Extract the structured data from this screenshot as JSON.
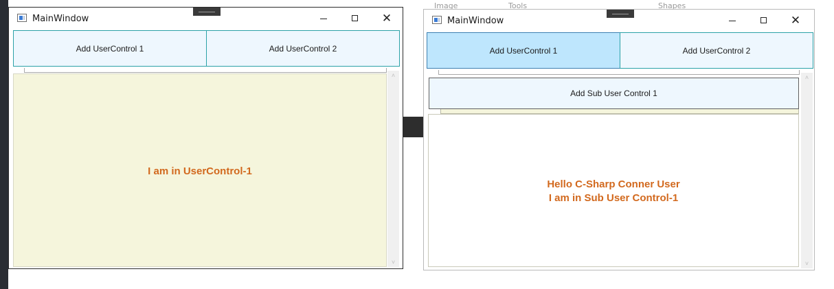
{
  "background": {
    "labels": [
      "Image",
      "Tools",
      "Shapes"
    ]
  },
  "windows": [
    {
      "title": "MainWindow",
      "buttons": {
        "add1": "Add UserControl 1",
        "add2": "Add UserControl 2"
      },
      "content": {
        "message": "I am in UserControl-1",
        "background": "#f5f5dc"
      },
      "scroll": {
        "up": "˄",
        "down": "˅"
      },
      "controls": {
        "close": "✕"
      }
    },
    {
      "title": "MainWindow",
      "buttons": {
        "add1": "Add UserControl 1",
        "add2": "Add UserControl 2"
      },
      "sub_button": "Add Sub User Control 1",
      "content": {
        "message_line1": "Hello C-Sharp Conner User",
        "message_line2": "I am in Sub User Control-1"
      },
      "scroll": {
        "up": "˄",
        "down": "˅"
      },
      "controls": {
        "close": "✕"
      }
    }
  ],
  "colors": {
    "accent_text": "#d2691e",
    "button_bg": "#eef7fe",
    "button_active": "#bee6fd",
    "button_border": "#2aa1a7"
  }
}
